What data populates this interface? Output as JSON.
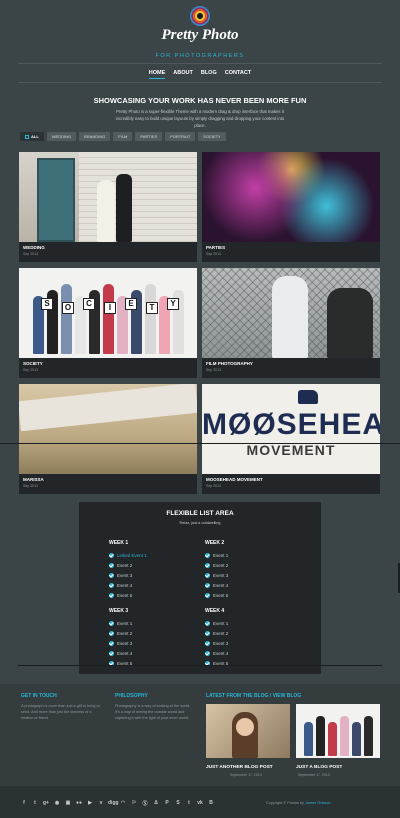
{
  "header": {
    "title": "Pretty Photo",
    "tagline": "FOR PHOTOGRAPHERS",
    "nav": [
      "HOME",
      "ABOUT",
      "BLOG",
      "CONTACT"
    ],
    "active_nav": "HOME"
  },
  "hero": {
    "headline": "SHOWCASING YOUR WORK HAS NEVER BEEN MORE FUN",
    "intro": "Pretty Photo is a super-flexible Theme with a modern drag & drop interface that makes it incredibly easy to build unique layouts by simply dragging and dropping your content into place."
  },
  "filters": [
    "ALL",
    "WEDDING",
    "BRANDING",
    "FILM",
    "PARTIES",
    "PORTRAIT",
    "SOCIETY"
  ],
  "portfolio": [
    {
      "title": "WEDDING",
      "date": "Sep 2013"
    },
    {
      "title": "PARTIES",
      "date": "Sep 2013"
    },
    {
      "title": "SOCIETY",
      "date": "Sep 2013"
    },
    {
      "title": "FILM PHOTOGRAPHY",
      "date": "Sep 2013"
    },
    {
      "title": "MARISSA",
      "date": "Sep 2013"
    },
    {
      "title": "MOOSEHEAD MOVEMENT",
      "date": "Sep 2013"
    }
  ],
  "society_signs": [
    "S",
    "O",
    "C",
    "I",
    "E",
    "T",
    "Y"
  ],
  "moose_image": {
    "word": "MØØSEHEAD",
    "sub": "MOVEMENT"
  },
  "flex_list": {
    "title": "FLEXIBLE LIST AREA",
    "subtitle": "Relax, just a outdwelling",
    "weeks": [
      {
        "heading": "WEEK 1",
        "events": [
          "Linked Event 1",
          "Event 2",
          "Event 3",
          "Event 4",
          "Event 5"
        ]
      },
      {
        "heading": "WEEK 2",
        "events": [
          "Event 1",
          "Event 2",
          "Event 3",
          "Event 4",
          "Event 5"
        ]
      },
      {
        "heading": "WEEK 3",
        "events": [
          "Event 1",
          "Event 2",
          "Event 3",
          "Event 4",
          "Event 5"
        ]
      },
      {
        "heading": "WEEK 4",
        "events": [
          "Event 1",
          "Event 2",
          "Event 3",
          "Event 4",
          "Event 5"
        ]
      }
    ]
  },
  "footer": {
    "get_in_touch": {
      "heading": "GET IN TOUCH",
      "text": "A photograph is more than just a gift to bring or send. And more than just the likeness of a relative or friend."
    },
    "philosophy": {
      "heading": "PHILOSOPHY",
      "text": "Photography is a way of looking at the world. It's a way of seeing the outside world and capturing it with the light of your inner world."
    },
    "blog": {
      "heading": "LATEST FROM THE BLOG / VIEW BLOG",
      "posts": [
        {
          "title": "JUST ANOTHER BLOG POST",
          "date": "September 17, 2013"
        },
        {
          "title": "JUST A BLOG POST",
          "date": "September 17, 2013"
        }
      ]
    },
    "social_icons": [
      "facebook-icon",
      "twitter-icon",
      "google-plus-icon",
      "dribbble-icon",
      "instagram-icon",
      "flickr-icon",
      "youtube-icon",
      "vimeo-icon",
      "digg-icon",
      "rss-icon",
      "lastfm-icon",
      "stumbleupon-icon",
      "deviantart-icon",
      "pinterest-icon",
      "skype-icon",
      "tumblr-icon",
      "vk-icon",
      "blogger-icon"
    ],
    "social_glyphs": [
      "f",
      "t",
      "g+",
      "◉",
      "▣",
      "●●",
      "▶",
      "v",
      "digg",
      "◠",
      "⚐",
      "Ⓢ",
      "Δ",
      "P",
      "S",
      "t",
      "vk",
      "B"
    ],
    "copyright_prefix": "Copyright © Photos by",
    "copyright_author": "James Grisson"
  },
  "colors": {
    "accent": "#29b6d8",
    "background": "#3b4447",
    "panel": "#222628"
  }
}
